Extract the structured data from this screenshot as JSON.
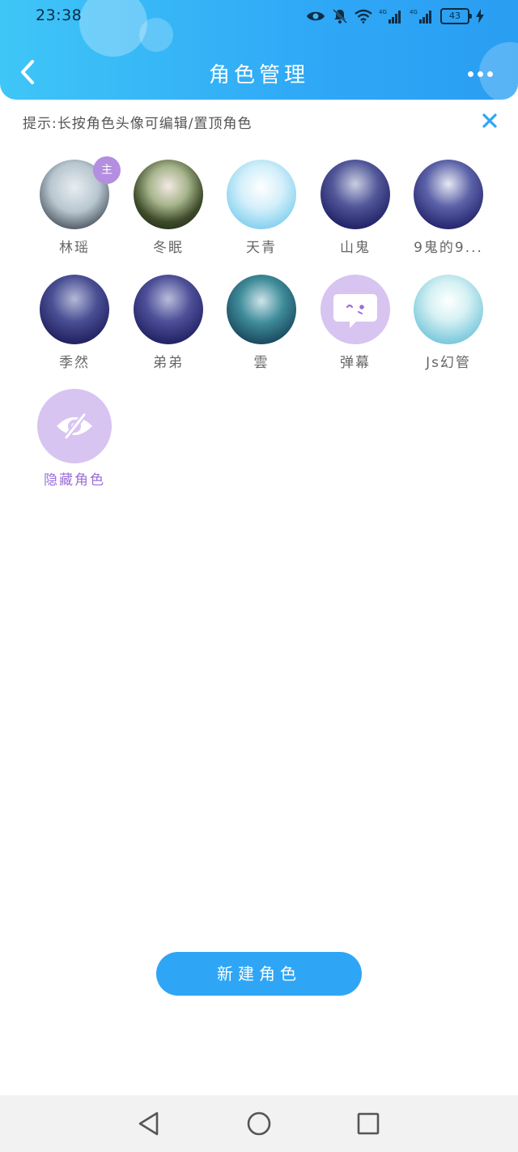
{
  "status_bar": {
    "time": "23:38",
    "battery": "43",
    "network_label": "4G"
  },
  "header": {
    "title": "角色管理"
  },
  "tip": {
    "text": "提示:长按角色头像可编辑/置顶角色"
  },
  "roles": [
    {
      "name": "林瑶",
      "badge": "主"
    },
    {
      "name": "冬眠"
    },
    {
      "name": "天青"
    },
    {
      "name": "山鬼"
    },
    {
      "name": "9鬼的9..."
    },
    {
      "name": "季然"
    },
    {
      "name": "弟弟"
    },
    {
      "name": "雲"
    },
    {
      "name": "弹幕"
    },
    {
      "name": "Js幻管"
    }
  ],
  "hidden_roles": {
    "label": "隐藏角色"
  },
  "new_role_button": {
    "label": "新建角色"
  },
  "colors": {
    "header_start": "#3fc6f7",
    "header_end": "#2a9ef2",
    "accent_purple": "#b48ee0",
    "button_blue": "#2fa6f5"
  }
}
